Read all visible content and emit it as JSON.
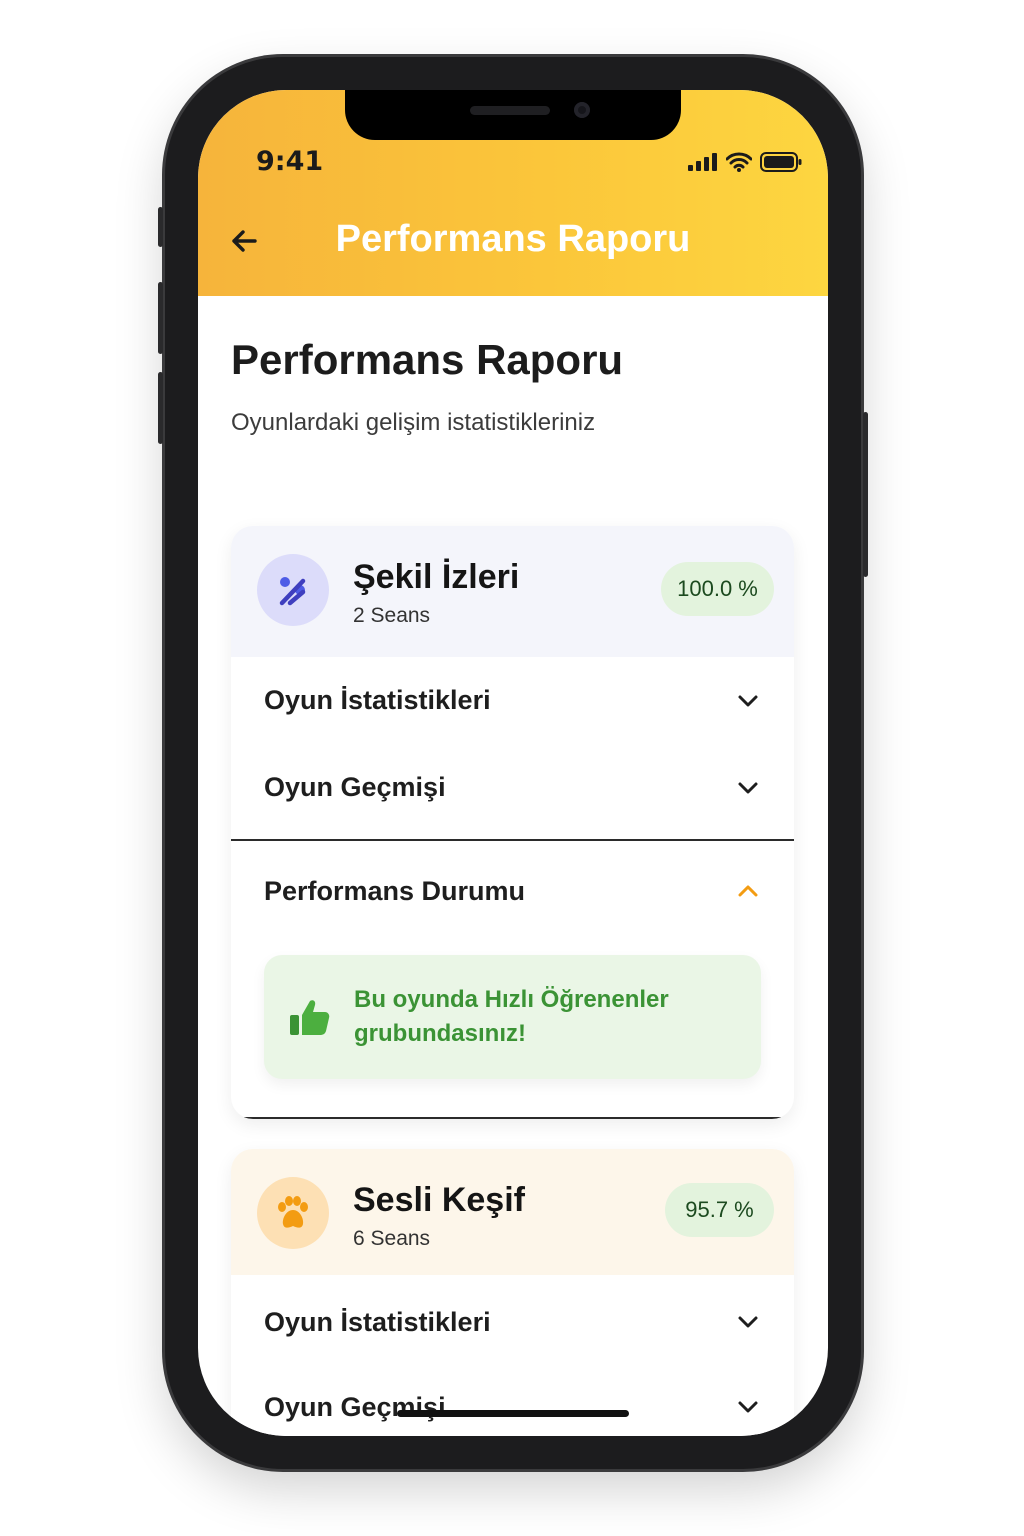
{
  "status_bar": {
    "time": "9:41"
  },
  "app_bar": {
    "title": "Performans Raporu"
  },
  "page": {
    "title": "Performans Raporu",
    "subtitle": "Oyunlardaki gelişim istatistikleriniz"
  },
  "games": [
    {
      "name": "Şekil İzleri",
      "sessions": "2 Seans",
      "score": "100.0 %",
      "icon": "percent-dots-icon",
      "rows": [
        {
          "label": "Oyun İstatistikleri",
          "expanded": false
        },
        {
          "label": "Oyun Geçmişi",
          "expanded": false
        },
        {
          "label": "Performans Durumu",
          "expanded": true
        }
      ],
      "performance_note": "Bu oyunda Hızlı Öğrenenler grubundasınız!"
    },
    {
      "name": "Sesli Keşif",
      "sessions": "6 Seans",
      "score": "95.7 %",
      "icon": "paw-icon",
      "rows": [
        {
          "label": "Oyun İstatistikleri",
          "expanded": false
        },
        {
          "label": "Oyun Geçmişi",
          "expanded": false
        }
      ]
    }
  ],
  "colors": {
    "header_start": "#f6b43b",
    "header_end": "#fdd640",
    "accent_orange": "#f39c12",
    "success_green": "#3b9335",
    "badge_bg": "#e3f3dd"
  }
}
